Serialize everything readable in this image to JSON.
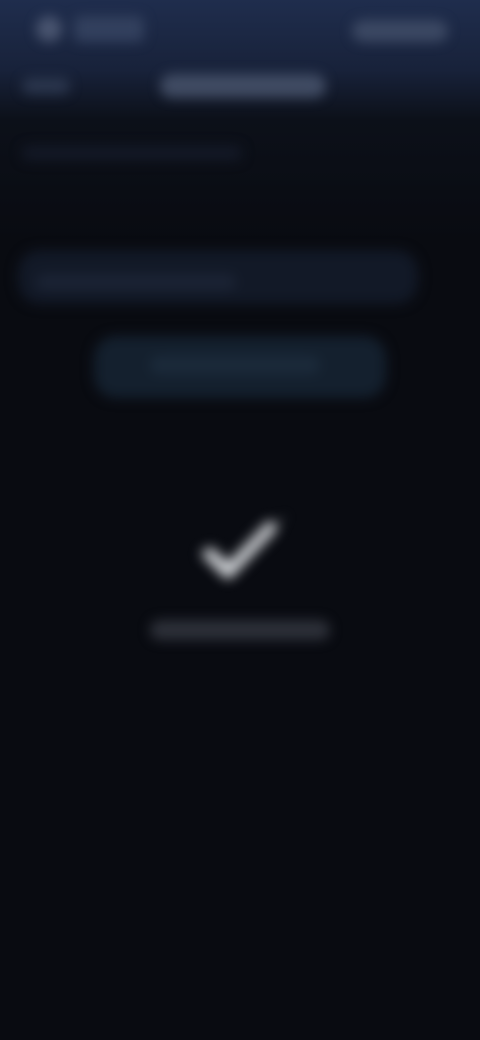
{
  "header": {
    "back_icon": "back-arrow-icon",
    "app_title": "",
    "action_label": "",
    "tabs": [
      {
        "label": ""
      },
      {
        "label": "",
        "active": true
      }
    ]
  },
  "main": {
    "subtitle": "",
    "info_card": {
      "text": ""
    },
    "primary_button": {
      "label": ""
    },
    "status": {
      "icon": "checkmark-icon",
      "caption": ""
    }
  },
  "colors": {
    "header_top": "#1f2d4d",
    "background": "#090b11",
    "card": "#121927",
    "button": "#14202e"
  }
}
